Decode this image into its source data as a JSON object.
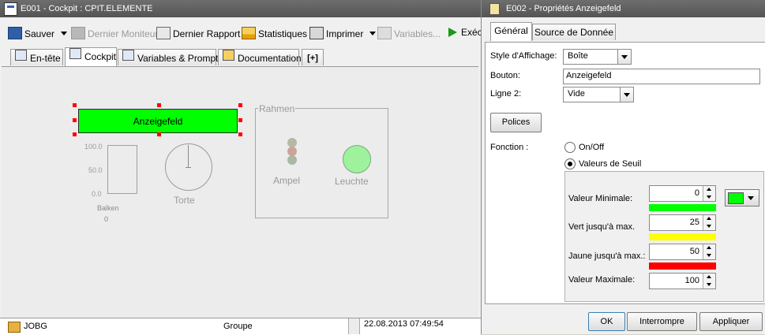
{
  "left_window": {
    "title": "E001 - Cockpit : CPIT.ELEMENTE",
    "toolbar": {
      "save": "Sauver",
      "last_monitor": "Dernier Moniteur",
      "last_report": "Dernier Rapport",
      "statistics": "Statistiques",
      "print": "Imprimer",
      "variables": "Variables...",
      "execute": "Exécu"
    },
    "tabs": [
      "En-tête",
      "Cockpit",
      "Variables & Prompts",
      "Documentation",
      "[+]"
    ],
    "active_tab": "Cockpit",
    "canvas": {
      "display_field": "Anzeigefeld",
      "bar_ticks": [
        "100.0",
        "50.0",
        "0.0"
      ],
      "bar_label": "Balken",
      "bar_value": "0",
      "pie_label": "Torte",
      "frame_label": "Rahmen",
      "traffic_light_label": "Ampel",
      "lamp_label": "Leuchte",
      "display_color": "#00ff00",
      "lamp_color": "#9ef29e"
    },
    "bottom_row": {
      "name": "JOBG",
      "type": "Groupe",
      "date": "22.08.2013 07:49:54"
    }
  },
  "dialog": {
    "title": "E002 - Propriétés Anzeigefeld",
    "tabs": [
      "Général",
      "Source de Donnée"
    ],
    "active_tab": "Général",
    "display_style_label": "Style d'Affichage:",
    "display_style_value": "Boîte",
    "button_label": "Bouton:",
    "button_value": "Anzeigefeld",
    "line2_label": "Ligne 2:",
    "line2_value": "Vide",
    "fonts_button": "Polices",
    "function_label": "Fonction :",
    "option_onoff": "On/Off",
    "option_thresholds": "Valeurs de Seuil",
    "selected_option": "Valeurs de Seuil",
    "min_label": "Valeur Minimale:",
    "min_value": "0",
    "green_label": "Vert jusqu'à max.",
    "green_value": "25",
    "yellow_label": "Jaune jusqu'à max.:",
    "yellow_value": "50",
    "max_label": "Valeur Maximale:",
    "max_value": "100",
    "colors": {
      "green": "#00ff00",
      "yellow": "#ffff00",
      "red": "#ff0000",
      "picker": "#00ff00"
    },
    "ok": "OK",
    "cancel": "Interrompre",
    "apply": "Appliquer"
  }
}
